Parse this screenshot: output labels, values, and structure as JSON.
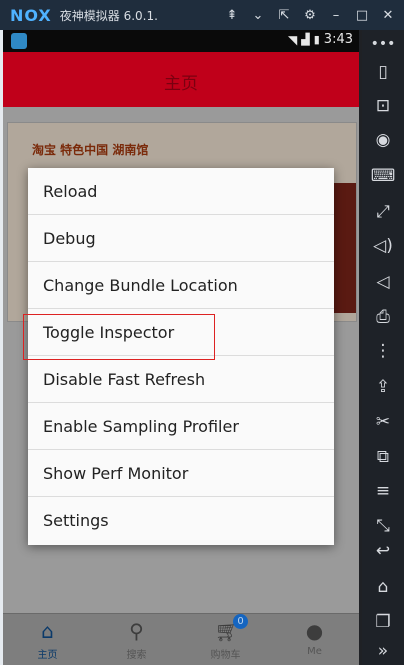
{
  "titlebar": {
    "logo": "NOX",
    "title": "夜神模拟器 6.0.1.",
    "icons": [
      "pin-icon",
      "chevron-down-icon",
      "fullscreen-icon",
      "settings-icon",
      "minimize-icon",
      "maximize-icon",
      "close-icon"
    ]
  },
  "statusbar": {
    "time": "3:43"
  },
  "navbar": {
    "title": "主页"
  },
  "banner": {
    "text": "淘宝 特色中国 湖南馆"
  },
  "menu": {
    "items": [
      "Reload",
      "Debug",
      "Change Bundle Location",
      "Toggle Inspector",
      "Disable Fast Refresh",
      "Enable Sampling Profiler",
      "Show Perf Monitor",
      "Settings"
    ]
  },
  "tabbar": {
    "tabs": [
      {
        "label": "主页",
        "icon": "home-icon"
      },
      {
        "label": "搜索",
        "icon": "search-icon"
      },
      {
        "label": "购物车",
        "icon": "cart-icon",
        "badge": "0"
      },
      {
        "label": "Me",
        "icon": "user-icon"
      }
    ]
  },
  "sidebar": {
    "icons": [
      "more-icon",
      "shake-icon",
      "robot-icon",
      "location-icon",
      "keyboard-icon",
      "resize-icon",
      "volume-up-icon",
      "volume-down-icon",
      "screenshot-icon",
      "macro-icon",
      "apk-install-icon",
      "cut-icon",
      "multi-instance-icon",
      "menu-icon",
      "controller-icon",
      "back-icon",
      "home-icon",
      "recent-apps-icon",
      "expand-icon"
    ]
  }
}
